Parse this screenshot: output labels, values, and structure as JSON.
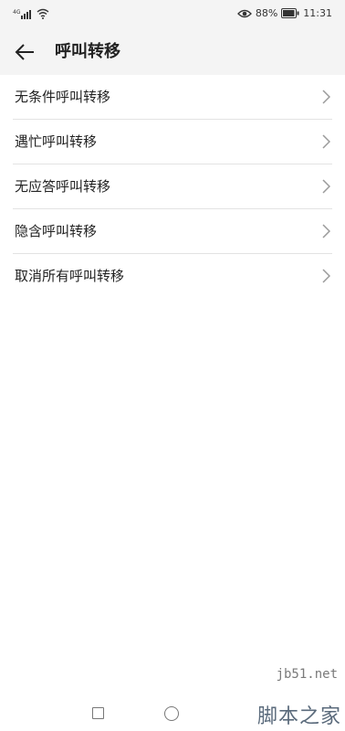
{
  "status_bar": {
    "network": "4G",
    "battery_percent": "88%",
    "time": "11:31"
  },
  "header": {
    "title": "呼叫转移"
  },
  "menu": {
    "items": [
      {
        "label": "无条件呼叫转移"
      },
      {
        "label": "遇忙呼叫转移"
      },
      {
        "label": "无应答呼叫转移"
      },
      {
        "label": "隐含呼叫转移"
      },
      {
        "label": "取消所有呼叫转移"
      }
    ]
  },
  "watermark": {
    "url": "jb51.net",
    "site_name": "脚本之家"
  },
  "icons": {
    "back": "arrow-left-icon",
    "chevron": "chevron-right-icon",
    "signal": "signal-icon",
    "wifi": "wifi-icon",
    "eye": "eye-comfort-icon",
    "battery": "battery-icon",
    "recent_apps": "square-icon",
    "home": "circle-icon"
  }
}
